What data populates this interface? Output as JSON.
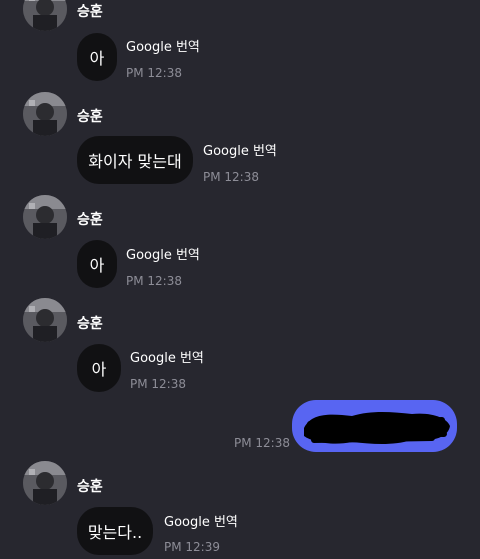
{
  "messages": [
    {
      "sender": "승훈",
      "text": "아",
      "translate": "Google 번역",
      "time": "PM 12:38"
    },
    {
      "sender": "승훈",
      "text": "화이자 맞는대",
      "translate": "Google 번역",
      "time": "PM 12:38"
    },
    {
      "sender": "승훈",
      "text": "아",
      "translate": "Google 번역",
      "time": "PM 12:38"
    },
    {
      "sender": "승훈",
      "text": "아",
      "translate": "Google 번역",
      "time": "PM 12:38"
    },
    {
      "sender": "승훈",
      "text": "맞는다..",
      "translate": "Google 번역",
      "time": "PM 12:39"
    }
  ],
  "my_message": {
    "time": "PM 12:38",
    "redacted": true
  },
  "colors": {
    "background": "#27272f",
    "incoming_bubble": "#111113",
    "outgoing_bubble": "#5865f2",
    "timestamp": "#8d8d97"
  }
}
